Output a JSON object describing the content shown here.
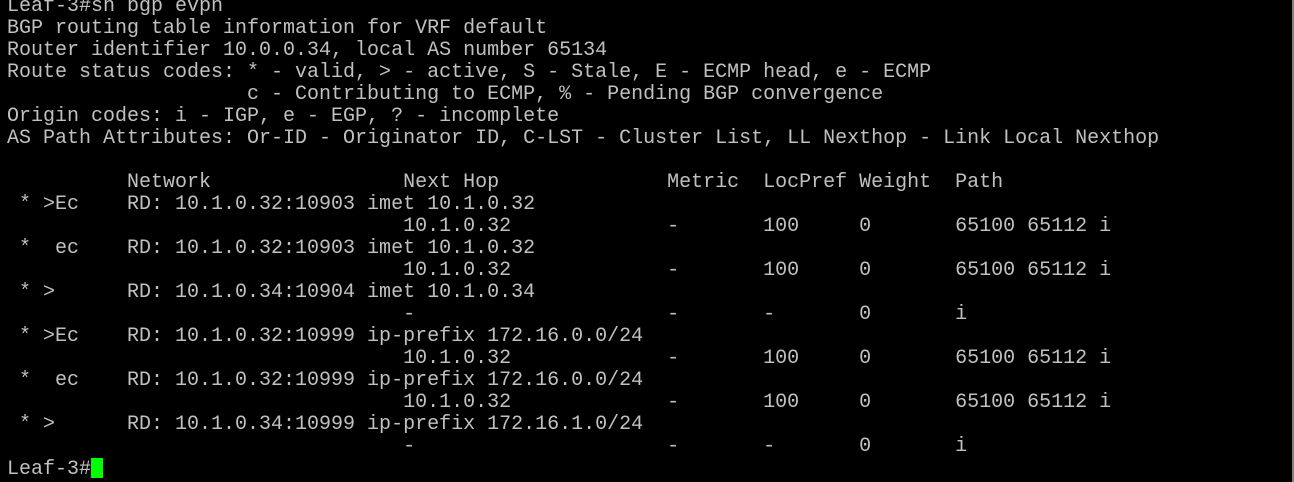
{
  "terminal": {
    "lines": [
      "Leaf-3#sh bgp evpn",
      "BGP routing table information for VRF default",
      "Router identifier 10.0.0.34, local AS number 65134",
      "Route status codes: * - valid, > - active, S - Stale, E - ECMP head, e - ECMP",
      "                    c - Contributing to ECMP, % - Pending BGP convergence",
      "Origin codes: i - IGP, e - EGP, ? - incomplete",
      "AS Path Attributes: Or-ID - Originator ID, C-LST - Cluster List, LL Nexthop - Link Local Nexthop",
      "",
      "          Network                Next Hop              Metric  LocPref Weight  Path",
      " * >Ec    RD: 10.1.0.32:10903 imet 10.1.0.32",
      "                                 10.1.0.32             -       100     0       65100 65112 i",
      " *  ec    RD: 10.1.0.32:10903 imet 10.1.0.32",
      "                                 10.1.0.32             -       100     0       65100 65112 i",
      " * >      RD: 10.1.0.34:10904 imet 10.1.0.34",
      "                                 -                     -       -       0       i",
      " * >Ec    RD: 10.1.0.32:10999 ip-prefix 172.16.0.0/24",
      "                                 10.1.0.32             -       100     0       65100 65112 i",
      " *  ec    RD: 10.1.0.32:10999 ip-prefix 172.16.0.0/24",
      "                                 10.1.0.32             -       100     0       65100 65112 i",
      " * >      RD: 10.1.0.34:10999 ip-prefix 172.16.1.0/24",
      "                                 -                     -       -       0       i"
    ],
    "prompt": "Leaf-3#",
    "colors": {
      "background": "#000000",
      "text": "#c0c0c0",
      "cursor": "#00ff00"
    }
  }
}
